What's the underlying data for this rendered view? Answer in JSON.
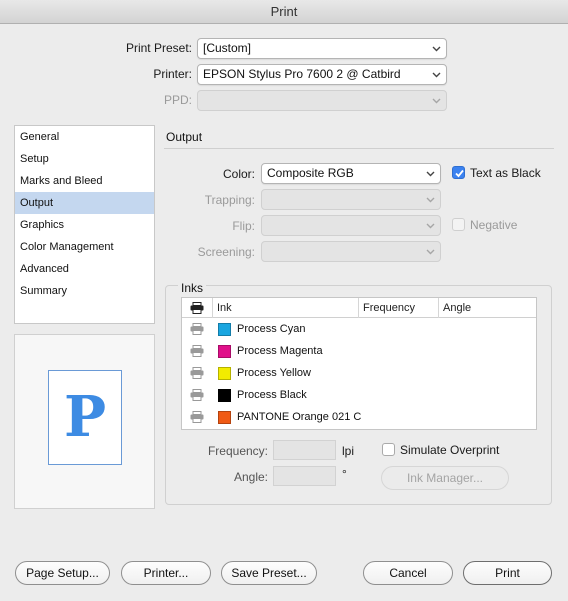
{
  "window": {
    "title": "Print"
  },
  "top": {
    "print_preset_label": "Print Preset:",
    "print_preset_value": "[Custom]",
    "printer_label": "Printer:",
    "printer_value": "EPSON Stylus Pro 7600 2 @ Catbird",
    "ppd_label": "PPD:",
    "ppd_value": ""
  },
  "sidebar": {
    "items": [
      {
        "label": "General"
      },
      {
        "label": "Setup"
      },
      {
        "label": "Marks and Bleed"
      },
      {
        "label": "Output"
      },
      {
        "label": "Graphics"
      },
      {
        "label": "Color Management"
      },
      {
        "label": "Advanced"
      },
      {
        "label": "Summary"
      }
    ],
    "selected": "Output"
  },
  "preview": {
    "glyph": "P"
  },
  "output": {
    "section_title": "Output",
    "color_label": "Color:",
    "color_value": "Composite RGB",
    "text_as_black_label": "Text as Black",
    "text_as_black_checked": true,
    "trapping_label": "Trapping:",
    "flip_label": "Flip:",
    "negative_label": "Negative",
    "negative_checked": false,
    "screening_label": "Screening:"
  },
  "inks": {
    "section_title": "Inks",
    "columns": [
      "Ink",
      "Frequency",
      "Angle"
    ],
    "rows": [
      {
        "name": "Process Cyan",
        "color": "#1aa6e0"
      },
      {
        "name": "Process Magenta",
        "color": "#e0108a"
      },
      {
        "name": "Process Yellow",
        "color": "#f2ec00"
      },
      {
        "name": "Process Black",
        "color": "#000000"
      },
      {
        "name": "PANTONE Orange 021 C",
        "color": "#f05a14"
      }
    ],
    "frequency_label": "Frequency:",
    "frequency_value": "",
    "frequency_unit": "lpi",
    "angle_label": "Angle:",
    "angle_value": "",
    "angle_unit": "°",
    "simulate_overprint_label": "Simulate Overprint",
    "simulate_overprint_checked": false,
    "ink_manager_label": "Ink Manager..."
  },
  "buttons": {
    "page_setup": "Page Setup...",
    "printer": "Printer...",
    "save_preset": "Save Preset...",
    "cancel": "Cancel",
    "print": "Print"
  },
  "colors": {
    "selection": "#c4d7ef",
    "checkbox_accent": "#3b82f0",
    "preview_glyph": "#3d8be3"
  }
}
